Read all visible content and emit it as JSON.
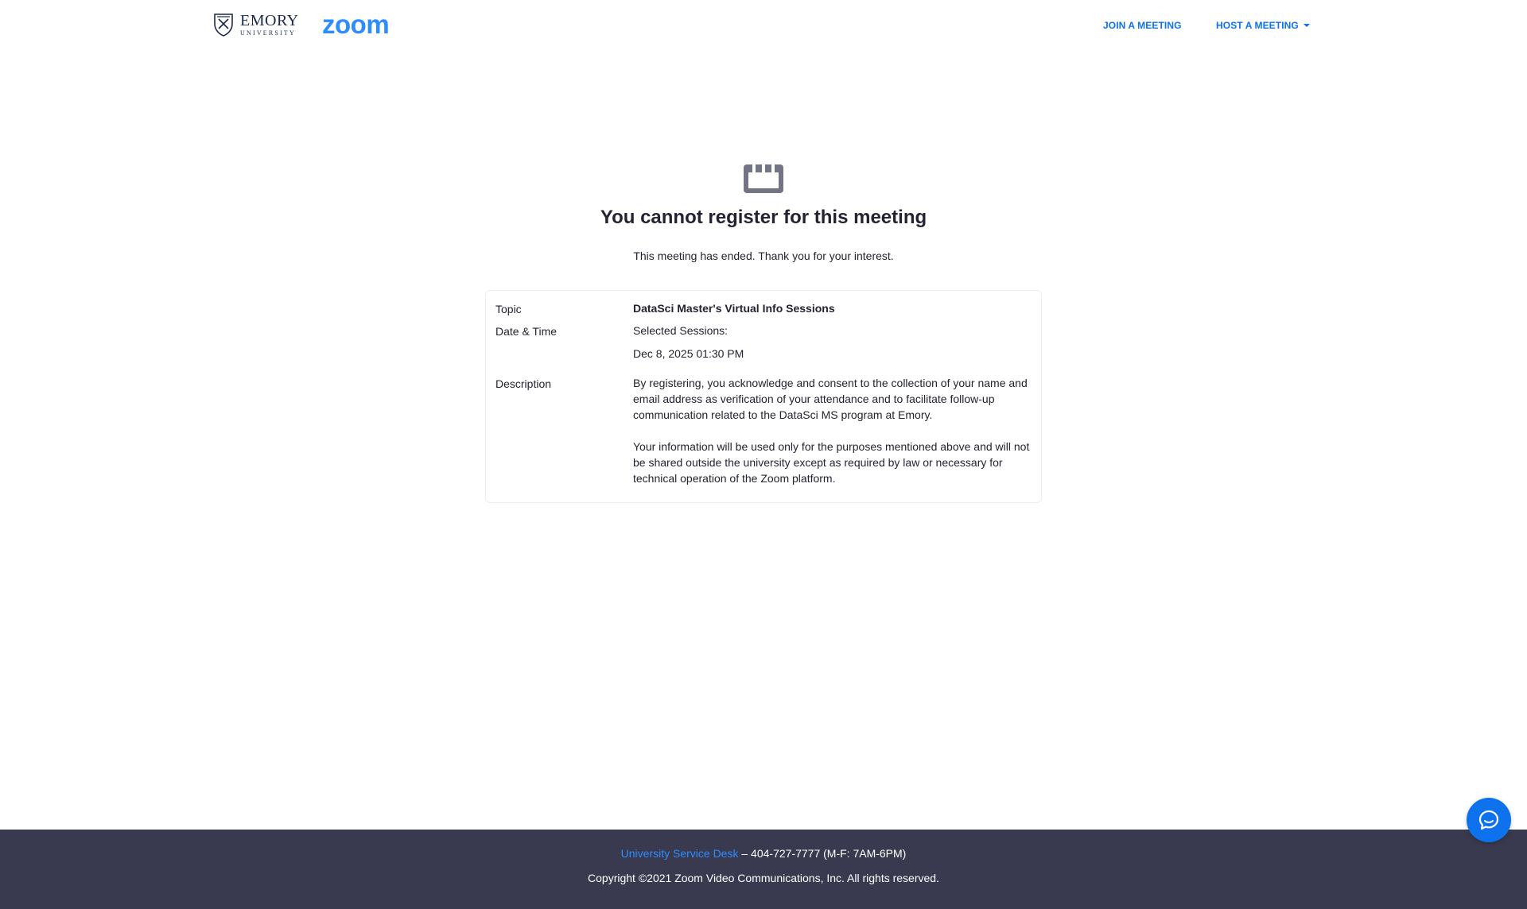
{
  "header": {
    "emory_logo": {
      "name": "EMORY",
      "sub": "UNIVERSITY"
    },
    "zoom_logo": "zoom",
    "nav": {
      "join_label": "JOIN A MEETING",
      "host_label": "HOST A MEETING"
    }
  },
  "main": {
    "title": "You cannot register for this meeting",
    "subtitle": "This meeting has ended. Thank you for your interest.",
    "details": {
      "topic_label": "Topic",
      "topic_value": "DataSci Master's Virtual Info Sessions",
      "datetime_label": "Date & Time",
      "datetime_heading": "Selected Sessions:",
      "datetime_value": "Dec 8, 2025 01:30 PM",
      "description_label": "Description",
      "description_p1": "By registering, you acknowledge and consent to the collection of your name and email address as verification of your attendance and to facilitate follow-up communication related to the DataSci MS program at Emory.",
      "description_p2": "Your information will be used only for the purposes mentioned above and will not be shared outside the university except as required by law or necessary for technical operation of the Zoom platform."
    }
  },
  "footer": {
    "service_desk_link": "University Service Desk",
    "service_desk_phone": " – 404-727-7777 (M-F: 7AM-6PM)",
    "copyright": "Copyright ©2021 Zoom Video Communications, Inc. All rights reserved."
  },
  "icons": {
    "notice": "calendar-ended-icon",
    "chat": "chat-bubble-icon",
    "emory": "emory-shield-icon"
  },
  "colors": {
    "accent": "#0e72ed",
    "zoom_brand": "#2d8cff",
    "footer_bg": "#393a4f",
    "text": "#232333",
    "icon_gray": "#747487"
  }
}
